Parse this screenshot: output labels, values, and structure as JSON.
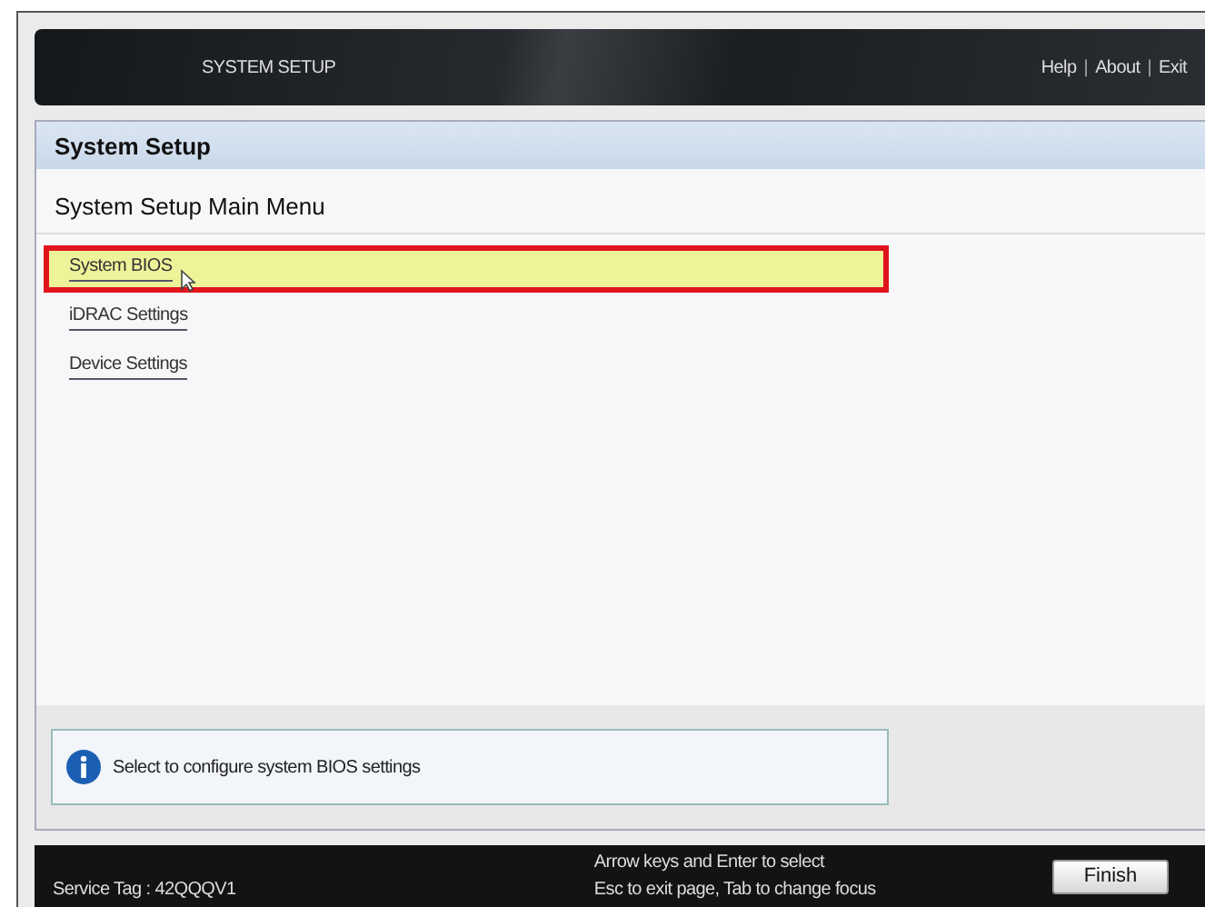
{
  "header": {
    "title": "SYSTEM SETUP",
    "links": [
      "Help",
      "About",
      "Exit"
    ],
    "separator": "|"
  },
  "panel": {
    "title": "System Setup",
    "heading": "System Setup Main Menu",
    "items": [
      {
        "label": "System BIOS",
        "selected": true
      },
      {
        "label": "iDRAC Settings",
        "selected": false
      },
      {
        "label": "Device Settings",
        "selected": false
      }
    ]
  },
  "info": {
    "text": "Select to configure system BIOS settings"
  },
  "footer": {
    "service_tag": "Service Tag : 42QQQV1",
    "hints": [
      "Arrow keys and Enter to select",
      "Esc to exit page, Tab to change focus"
    ],
    "button": "Finish"
  }
}
